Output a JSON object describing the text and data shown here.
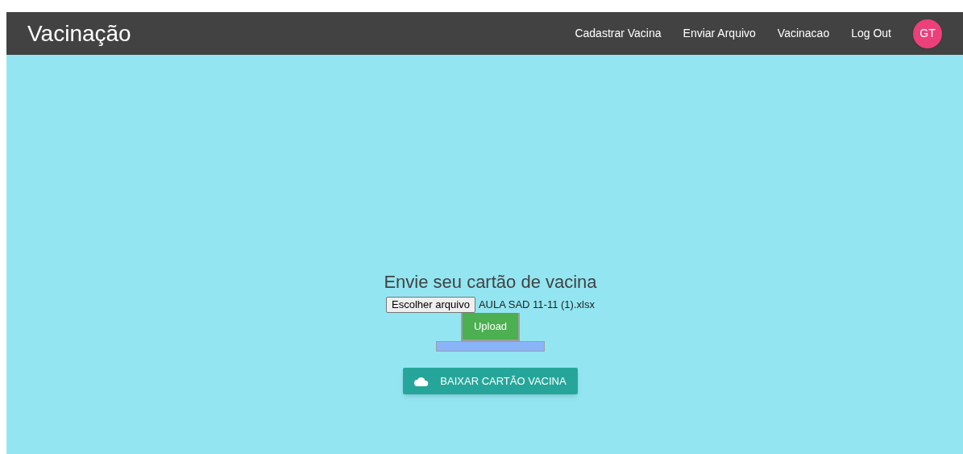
{
  "navbar": {
    "brand": "Vacinação",
    "links": [
      "Cadastrar Vacina",
      "Enviar Arquivo",
      "Vacinacao",
      "Log Out"
    ],
    "avatar": "GT"
  },
  "upload": {
    "title": "Envie seu cartão de vacina",
    "choose_button": "Escolher arquivo",
    "file_name": "AULA SAD 11-11 (1).xlsx",
    "upload_button": "Upload",
    "progress": {
      "level": 1
    }
  },
  "download_button": "BAIXAR CARTÃO VACINA"
}
